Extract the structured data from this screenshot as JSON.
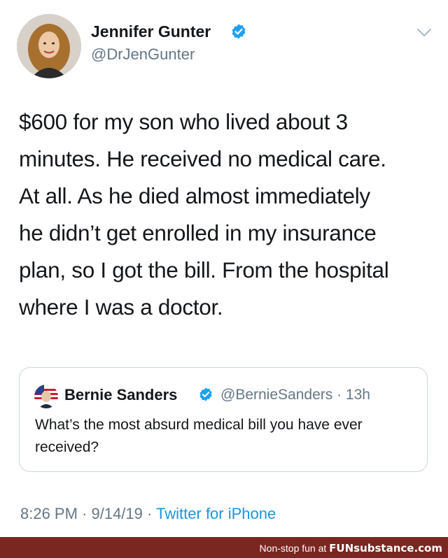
{
  "tweet": {
    "author": {
      "name": "Jennifer Gunter",
      "handle": "@DrJenGunter",
      "verified_icon": "verified-badge-icon"
    },
    "more_icon": "chevron-down-icon",
    "text_lines": [
      "$600 for my son who lived about 3",
      "minutes. He received no medical care.",
      "At all. As he died almost immediately",
      "he didn’t get enrolled in my insurance",
      "plan, so I got the bill.  From the hospital",
      "where I was a doctor."
    ],
    "quoted": {
      "name": "Bernie Sanders",
      "meta": "@BernieSanders · 13h",
      "text": "What’s the most absurd medical bill you have ever received?"
    },
    "footer": {
      "time_date": "8:26 PM · 9/14/19 · ",
      "source": "Twitter for iPhone"
    }
  },
  "watermark": {
    "prefix": "Non-stop fun at ",
    "brand": "FUNsubstance.com"
  },
  "colors": {
    "text": "#14171a",
    "secondary": "#657786",
    "link": "#1b95e0",
    "verified": "#1da1f2",
    "border": "#ccd6dd",
    "banner": "#7a2621"
  }
}
